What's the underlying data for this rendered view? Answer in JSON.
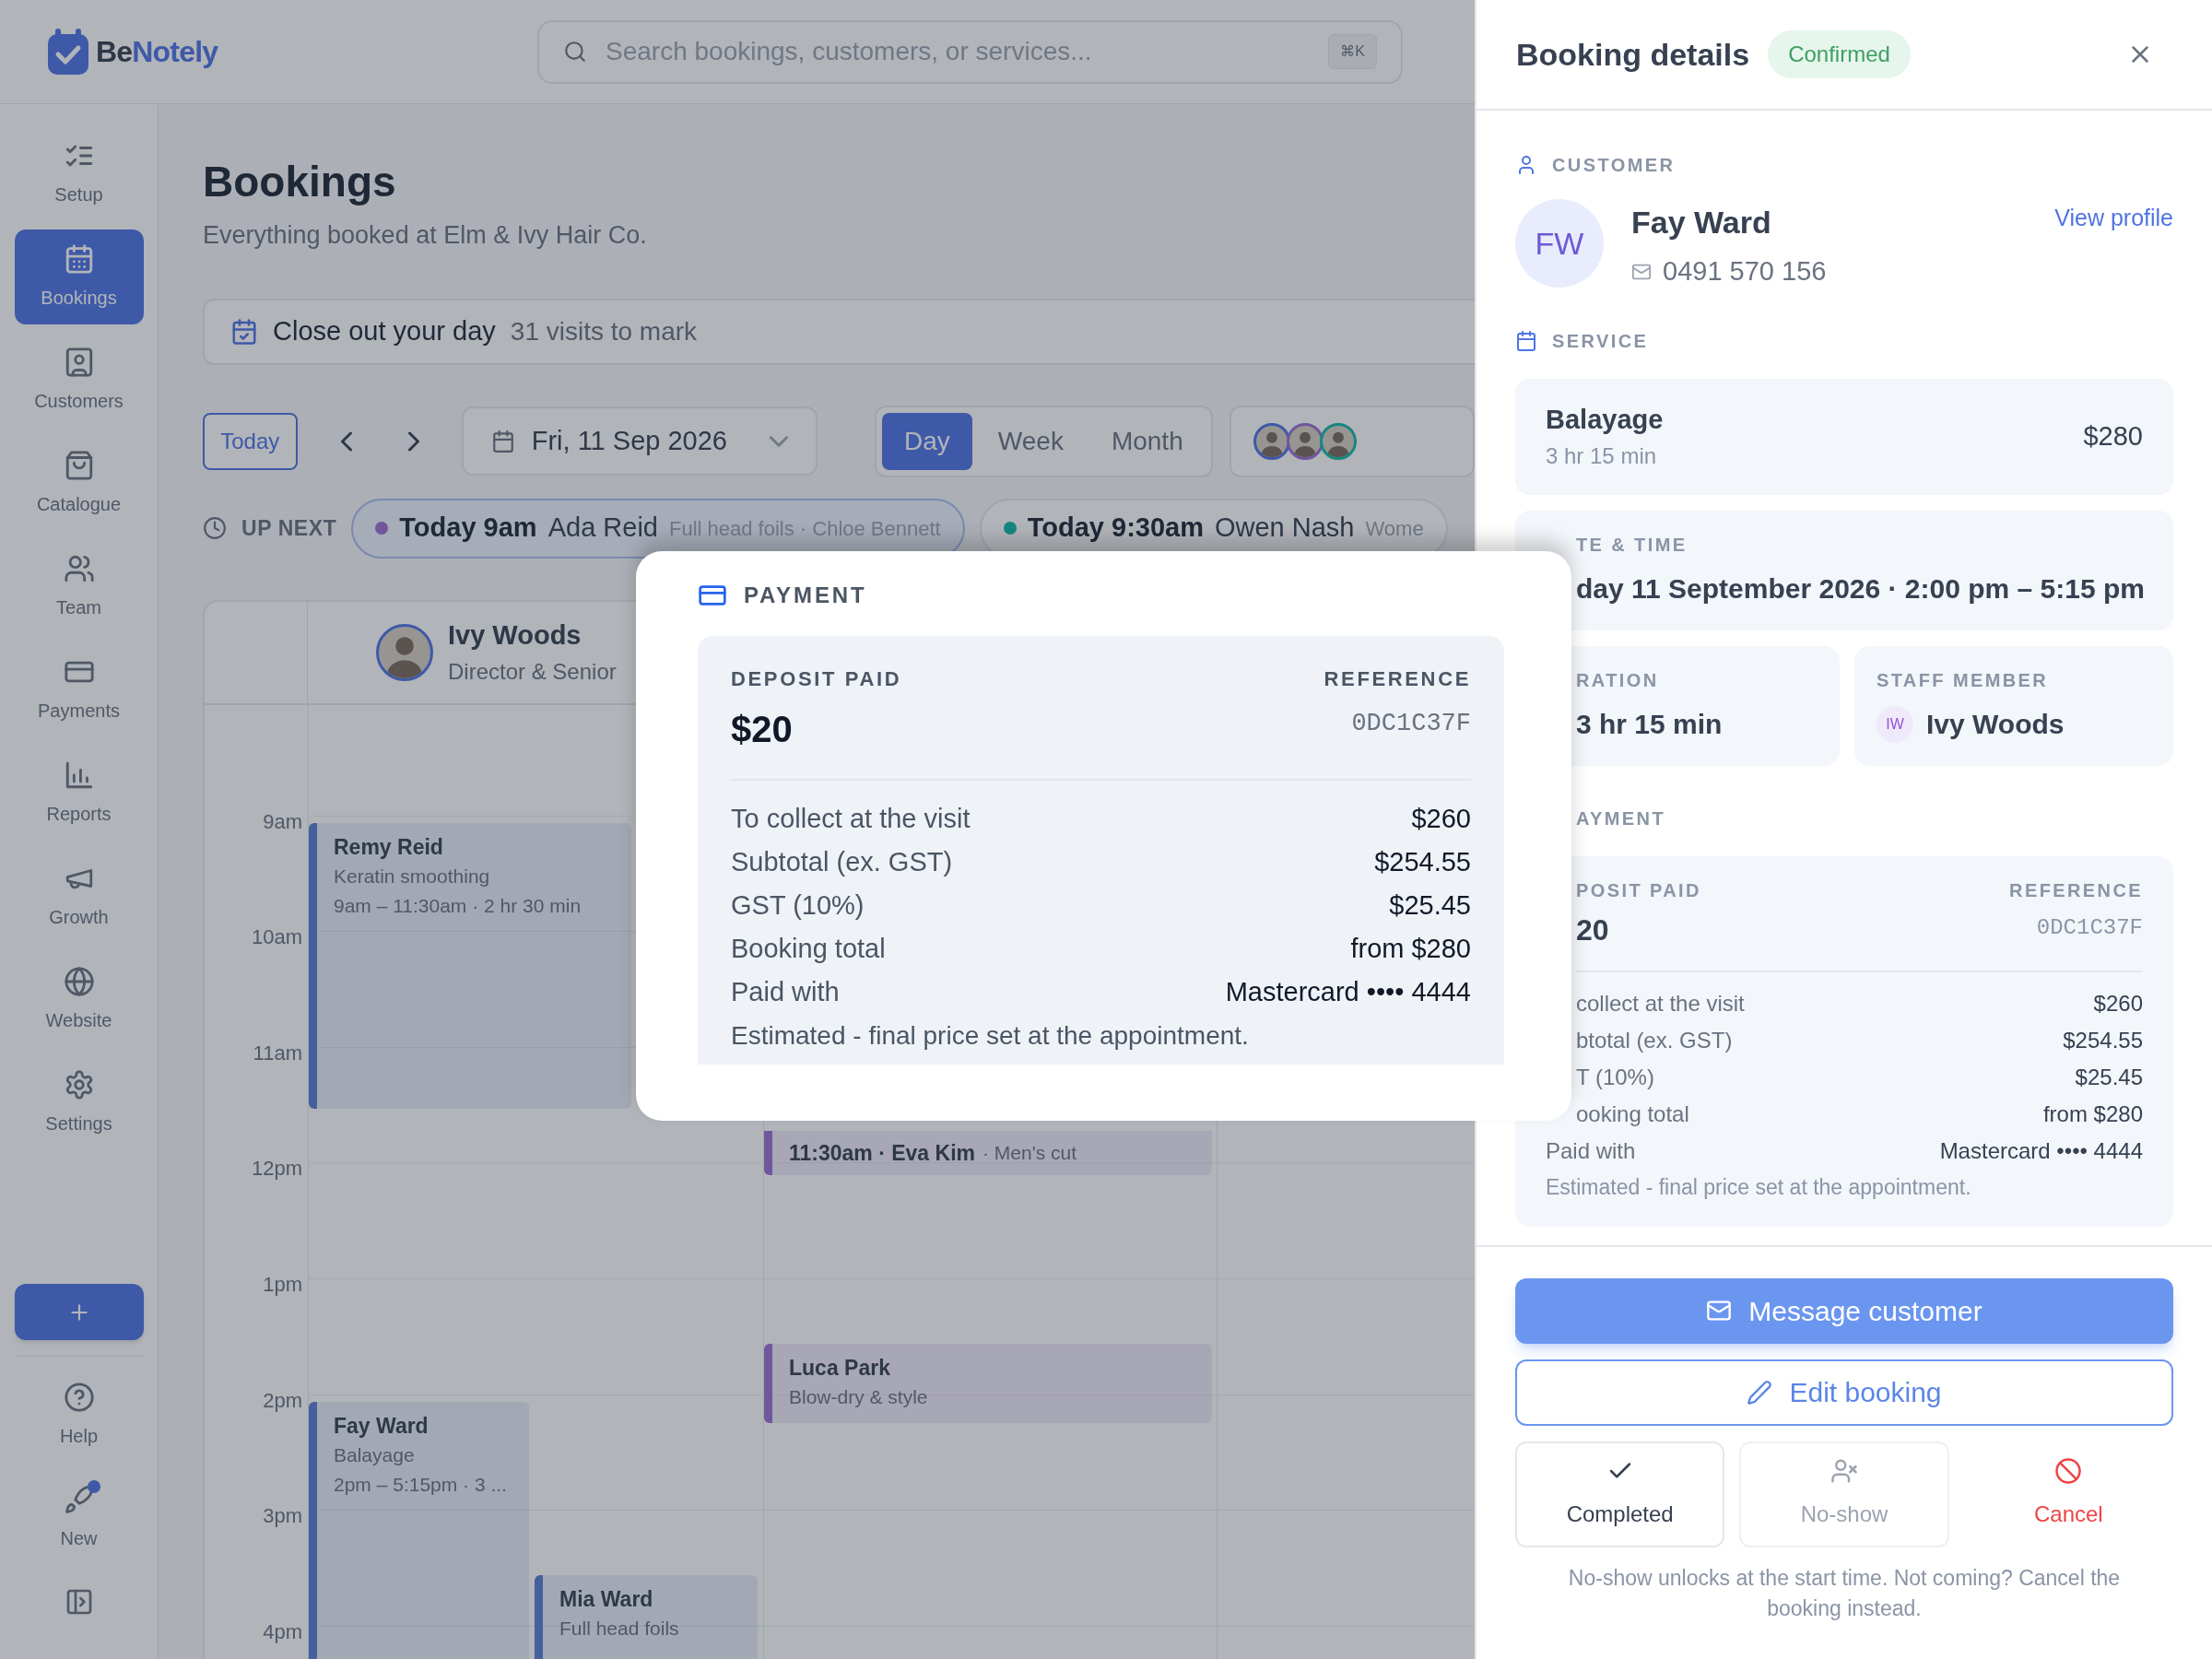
{
  "brand": {
    "prefix": "Be",
    "suffix": "Notely"
  },
  "search": {
    "placeholder": "Search bookings, customers, or services...",
    "shortcut": "⌘K"
  },
  "sidebar": {
    "items": [
      {
        "label": "Setup",
        "selected": false
      },
      {
        "label": "Bookings",
        "selected": true
      },
      {
        "label": "Customers",
        "selected": false
      },
      {
        "label": "Catalogue",
        "selected": false
      },
      {
        "label": "Team",
        "selected": false
      },
      {
        "label": "Payments",
        "selected": false
      },
      {
        "label": "Reports",
        "selected": false
      },
      {
        "label": "Growth",
        "selected": false
      },
      {
        "label": "Website",
        "selected": false
      },
      {
        "label": "Settings",
        "selected": false
      }
    ],
    "footer_items": [
      {
        "label": "Help",
        "dot": false
      },
      {
        "label": "New",
        "dot": true
      }
    ]
  },
  "page": {
    "title": "Bookings",
    "subtitle": "Everything booked at Elm & Ivy Hair Co."
  },
  "closeout": {
    "title": "Close out your day",
    "count": "31 visits to mark"
  },
  "controls": {
    "today": "Today",
    "date": "Fri, 11 Sep 2026",
    "views": [
      {
        "label": "Day",
        "selected": true
      },
      {
        "label": "Week",
        "selected": false
      },
      {
        "label": "Month",
        "selected": false
      }
    ]
  },
  "up_next": {
    "label": "UP NEXT",
    "items": [
      {
        "when": "Today 9am",
        "name": "Ada Reid",
        "detail": "Full head foils · Chloe Bennett",
        "color": "#70579e"
      },
      {
        "when": "Today 9:30am",
        "name": "Owen Nash",
        "detail": "Wome",
        "color": "#18867f"
      }
    ]
  },
  "calendar": {
    "staff": [
      {
        "name": "Ivy Woods",
        "role": "Director & Senior"
      }
    ],
    "hours": [
      "9am",
      "10am",
      "11am",
      "12pm",
      "1pm",
      "2pm",
      "3pm",
      "4pm"
    ],
    "columns": [
      {
        "events": [
          {
            "name": "Remy Reid",
            "service": "Keratin smoothing",
            "time": "9am – 11:30am · 2 hr 30 min",
            "color": "#46619e"
          },
          {
            "name": "Fay Ward",
            "service": "Balayage",
            "time": "2pm – 5:15pm · 3 ...",
            "color": "#46619e"
          },
          {
            "name": "Mia Ward",
            "service": "Full head foils",
            "color": "#46619e"
          }
        ]
      },
      {
        "events": [
          {
            "name": "11:30am · Eva Kim",
            "service": "· Men's cut",
            "color": "#70579e"
          },
          {
            "name": "Luca Park",
            "service": "Blow-dry & style",
            "color": "#70579e"
          }
        ]
      }
    ]
  },
  "booking_details": {
    "title": "Booking details",
    "status": "Confirmed",
    "customer": {
      "section": "CUSTOMER",
      "initials": "FW",
      "name": "Fay Ward",
      "phone": "0491 570 156",
      "link": "View profile"
    },
    "service": {
      "section": "SERVICE",
      "name": "Balayage",
      "duration": "3 hr 15 min",
      "price": "$280"
    },
    "date_time": {
      "label": "TE & TIME",
      "value": "day 11 September 2026 · 2:00 pm – 5:15 pm"
    },
    "duration": {
      "label": "RATION",
      "value": "3 hr 15 min"
    },
    "staff": {
      "label": "STAFF MEMBER",
      "initials": "IW",
      "name": "Ivy Woods"
    },
    "payment": {
      "section": "AYMENT",
      "deposit_label": "POSIT PAID",
      "deposit": "20",
      "reference_label": "REFERENCE",
      "reference": "0DC1C37F",
      "rows": [
        {
          "label": "collect at the visit",
          "value": "$260"
        },
        {
          "label": "btotal (ex. GST)",
          "value": "$254.55"
        },
        {
          "label": "T (10%)",
          "value": "$25.45"
        },
        {
          "label": "ooking total",
          "value": "from $280"
        },
        {
          "label": "Paid with",
          "value": "Mastercard •••• 4444"
        }
      ],
      "note": "Estimated - final price set at the appointment."
    },
    "primary_action": "Message customer",
    "secondary_action": "Edit booking",
    "status_actions": [
      {
        "label": "Completed",
        "kind": "complete",
        "disabled": false
      },
      {
        "label": "No-show",
        "kind": "noshow",
        "disabled": true
      },
      {
        "label": "Cancel",
        "kind": "cancel",
        "disabled": false
      }
    ],
    "hint": "No-show unlocks at the start time. Not coming? Cancel the booking instead."
  },
  "payment_popup": {
    "section": "PAYMENT",
    "deposit_label": "DEPOSIT PAID",
    "deposit": "$20",
    "reference_label": "REFERENCE",
    "reference": "0DC1C37F",
    "rows": [
      {
        "label": "To collect at the visit",
        "value": "$260"
      },
      {
        "label": "Subtotal (ex. GST)",
        "value": "$254.55"
      },
      {
        "label": "GST (10%)",
        "value": "$25.45"
      },
      {
        "label": "Booking total",
        "value": "from $280"
      },
      {
        "label": "Paid with",
        "value": "Mastercard •••• 4444"
      }
    ],
    "note": "Estimated - final price set at the appointment."
  }
}
